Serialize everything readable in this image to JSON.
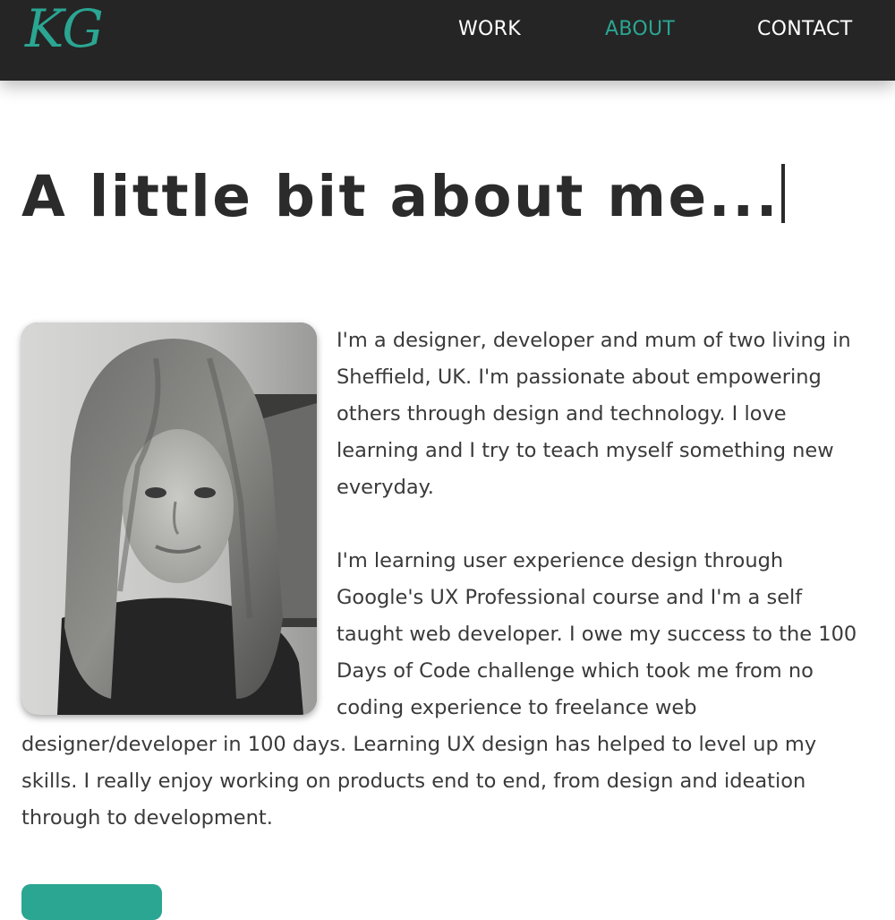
{
  "nav": {
    "logo": "KG",
    "items": [
      {
        "label": "WORK",
        "active": false
      },
      {
        "label": "ABOUT",
        "active": true
      },
      {
        "label": "CONTACT",
        "active": false
      }
    ]
  },
  "about": {
    "heading": "A little bit about me...",
    "paragraphs": [
      "I'm a designer, developer and mum of two living in Sheffield, UK. I'm passionate about empowering others through design and technology. I love learning and I try to teach myself something new everyday.",
      "I'm learning user experience design through Google's UX Professional course and I'm a self taught web developer. I owe my success to the 100 Days of Code challenge which took me from no coding experience to freelance web designer/developer in 100 days. Learning UX design has helped to level up my skills. I really enjoy working on products end to end, from design and ideation through to development."
    ]
  },
  "colors": {
    "accent": "#2aa692",
    "navbar": "#252525",
    "text": "#333333",
    "background": "#ffffff"
  }
}
